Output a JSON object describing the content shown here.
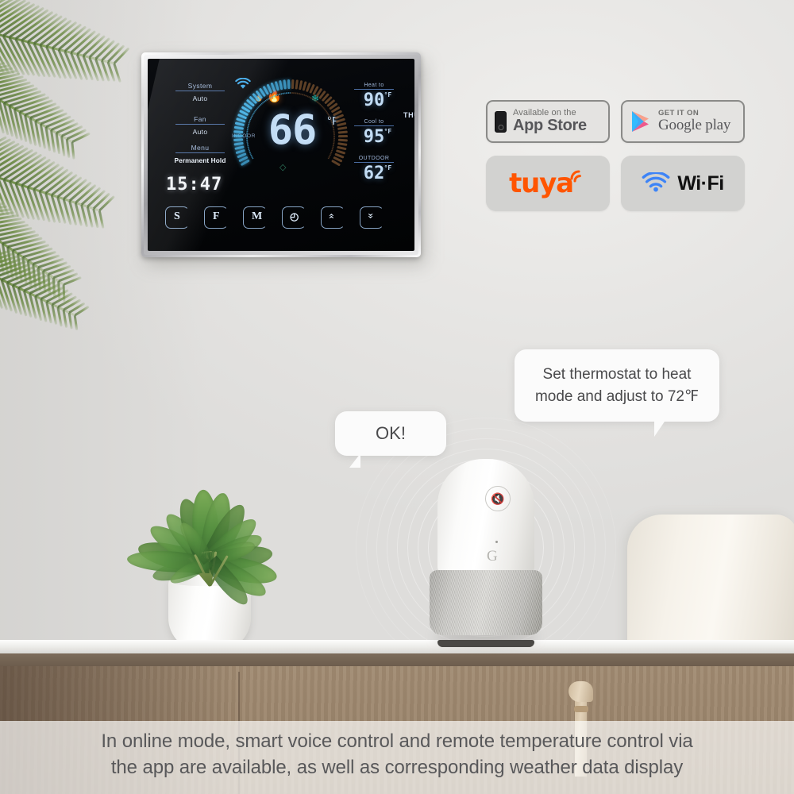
{
  "scene": {
    "description": "Smart wall thermostat with voice assistant in a living room",
    "wall_color": "#e7e6e4"
  },
  "thermostat": {
    "left_panel": [
      {
        "key": "System",
        "value": "Auto"
      },
      {
        "key": "Fan",
        "value": "Auto"
      },
      {
        "key": "Menu",
        "value": "Permanent Hold"
      }
    ],
    "wifi_icon": "wifi-icon",
    "dial": {
      "indoor_label": "INDOOR",
      "temperature": "66",
      "unit": "°F",
      "active_color": "#49b4e8",
      "inactive_color": "#6d4a2c",
      "icons": [
        "flame-small-icon",
        "flame-large-icon",
        "fan-icon",
        "humidity-drop-icon"
      ]
    },
    "right_panel": [
      {
        "key": "Heat to",
        "value": "90",
        "unit": "°F"
      },
      {
        "key": "Cool  to",
        "value": "95",
        "unit": "°F"
      },
      {
        "key": "OUTDOOR",
        "value": "62",
        "unit": "°F"
      }
    ],
    "day": "THU",
    "clock": "15:47",
    "buttons": [
      {
        "glyph": "S",
        "name": "system-button"
      },
      {
        "glyph": "F",
        "name": "fan-button"
      },
      {
        "glyph": "M",
        "name": "menu-button"
      },
      {
        "glyph": "◐",
        "name": "clock-button"
      },
      {
        "glyph": "⌃",
        "name": "temp-up-button"
      },
      {
        "glyph": "⌄",
        "name": "temp-down-button"
      }
    ]
  },
  "badges": {
    "app_store": {
      "line1": "Available on the",
      "line2": "App Store"
    },
    "google_play": {
      "line1": "GET IT ON",
      "line2": "Google play"
    },
    "tuya": {
      "label": "tuya",
      "color": "#ff5500"
    },
    "wifi": {
      "label": "Wi·Fi",
      "icon_color": "#3d84f7"
    }
  },
  "bubbles": {
    "command": "Set thermostat to heat mode and adjust to 72℉",
    "reply": "OK!"
  },
  "speaker": {
    "name": "google-home-speaker",
    "logo": "G",
    "mute_icon": "microphone-mute-icon"
  },
  "caption": {
    "line1": "In online mode, smart voice control and remote temperature control via",
    "line2": "the app are available, as well as corresponding weather data display"
  }
}
